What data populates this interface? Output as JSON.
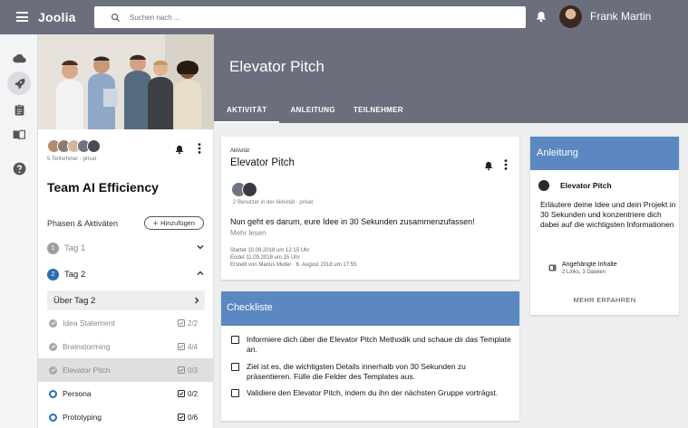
{
  "app": {
    "logo": "Joolia"
  },
  "search": {
    "placeholder": "Suchen nach ..."
  },
  "user": {
    "name": "Frank Martin"
  },
  "page": {
    "title": "Elevator Pitch"
  },
  "tabs": [
    {
      "label": "AKTIVITÄT",
      "active": true
    },
    {
      "label": "ANLEITUNG",
      "active": false
    },
    {
      "label": "TEILNEHMER",
      "active": false
    }
  ],
  "team": {
    "members_text": "5 Teilnehmer · privat",
    "name": "Team AI Efficiency",
    "phases_label": "Phasen & Aktiväten",
    "add_label": "Hinzufügen"
  },
  "days": [
    {
      "num": "1",
      "label": "Tag 1",
      "expanded": false
    },
    {
      "num": "2",
      "label": "Tag 2",
      "expanded": true
    }
  ],
  "sub_tag": {
    "label": "Über Tag 2"
  },
  "activities": [
    {
      "label": "Idea Statement",
      "count": "2/2",
      "status": "done"
    },
    {
      "label": "Brainstorming",
      "count": "4/4",
      "status": "done"
    },
    {
      "label": "Elevator Pitch",
      "count": "0/3",
      "status": "done"
    },
    {
      "label": "Persona",
      "count": "0/2",
      "status": "open"
    },
    {
      "label": "Prototyping",
      "count": "0/6",
      "status": "open"
    }
  ],
  "activity_card": {
    "kicker": "Aktivität",
    "title": "Elevator Pitch",
    "users": "2 Benutzer in der Aktivität · privat",
    "message": "Nun geht es darum, eure Idee in 30 Sekunden zusammenzufassen!",
    "more_link": "Mehr lesen",
    "started": "Startet 10.09.2018 um 12:15 Uhr",
    "ends": "Endet 11.09.2018 um 15 Uhr",
    "created": "Erstellt von Marius Muller · 6. August 2018 um 17:55"
  },
  "checklist": {
    "title": "Checkliste",
    "items": [
      "Informiere dich über die Elevator Pitch Methodik und schaue dir das Template an.",
      "Ziel ist es, die wichtigsten Details innerhalb von 30 Sekunden zu präsentieren. Fülle die Felder des Templates aus.",
      "Validiere den Elevator Pitch, indem du ihn der nächsten Gruppe vorträgst."
    ]
  },
  "instructions": {
    "title": "Anleitung",
    "author": "Elevator Pitch",
    "text": "Erläutere deine Idee und dein Projekt in 30 Sekunden und konzentriere dich dabei auf die wichtigsten Informationen",
    "attach_title": "Angehängte Inhalte",
    "attach_sub": "2 Links, 3 Dateien",
    "learn_more": "MEHR ERFAHREN"
  },
  "colors": {
    "topbar": "#6b6f7d",
    "accent_blue": "#5b88c0",
    "day_badge_inactive": "#9e9e9e",
    "day_badge_active": "#2a6db3"
  }
}
